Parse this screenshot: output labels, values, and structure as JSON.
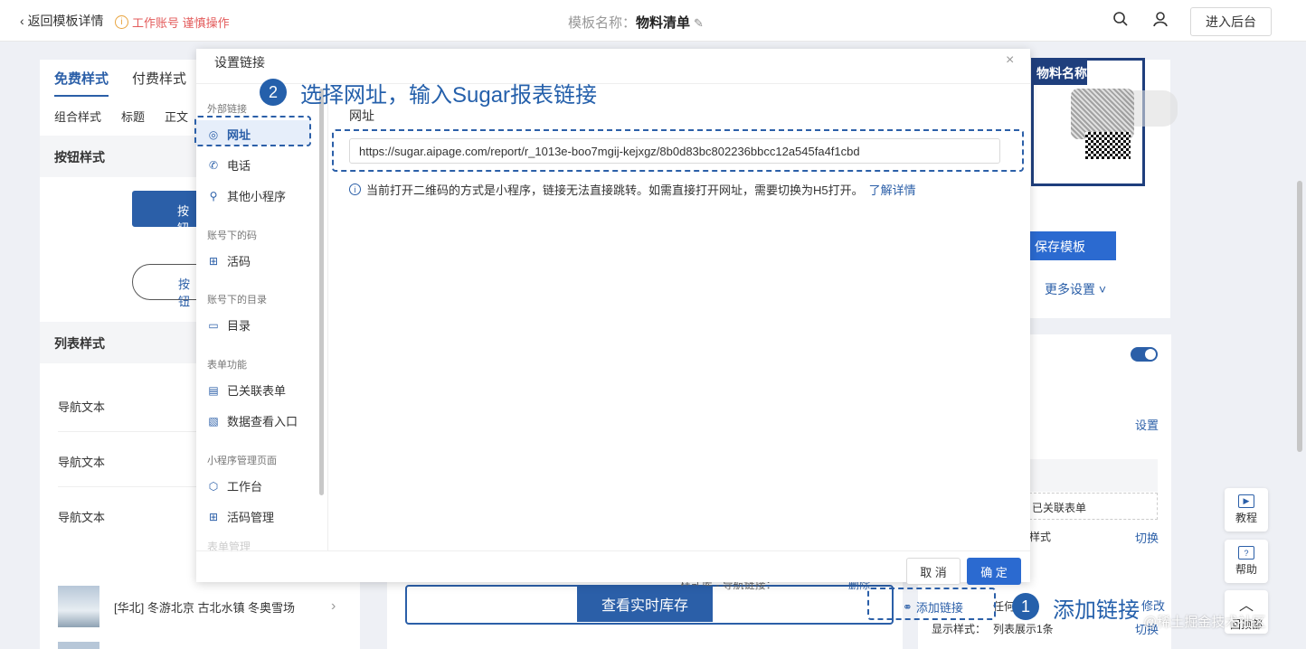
{
  "topbar": {
    "back_label": "返回模板详情",
    "warning_text": "工作账号 谨慎操作",
    "template_name_label": "模板名称：",
    "template_name": "物料清单",
    "enter_backend": "进入后台"
  },
  "left_panel": {
    "tabs": [
      "免费样式",
      "付费样式"
    ],
    "subtabs": [
      "组合样式",
      "标题",
      "正文"
    ],
    "button_section": "按钮样式",
    "button_text": "按钮",
    "list_section": "列表样式",
    "nav_items": [
      "导航文本",
      "导航文本",
      "导航文本"
    ],
    "list_item_text": "[华北] 冬游北京 古北水镇 冬奥雪场"
  },
  "center": {
    "stock_button": "查看实时库存",
    "behind_text": "样式库 - 导航链接：",
    "delete_text": "删除",
    "add_link": "添加链接"
  },
  "right": {
    "poster_title": "物料名称",
    "save_template": "保存模板",
    "more_settings": "更多设置",
    "setting_link": "设置",
    "linked_form": "已关联表单",
    "style_label": "样式",
    "switch_label": "切换",
    "modify_label": "修改",
    "any_label": "任何",
    "display_style": "显示样式：",
    "display_value": "列表展示1条",
    "help_btns": [
      "教程",
      "帮助",
      "回顶部"
    ]
  },
  "modal": {
    "title": "设置链接",
    "groups": [
      {
        "title": "外部链接",
        "items": [
          {
            "label": "网址",
            "icon": "globe-icon"
          },
          {
            "label": "电话",
            "icon": "phone-icon"
          },
          {
            "label": "其他小程序",
            "icon": "link-icon"
          }
        ]
      },
      {
        "title": "账号下的码",
        "items": [
          {
            "label": "活码",
            "icon": "grid-icon"
          }
        ]
      },
      {
        "title": "账号下的目录",
        "items": [
          {
            "label": "目录",
            "icon": "folder-icon"
          }
        ]
      },
      {
        "title": "表单功能",
        "items": [
          {
            "label": "已关联表单",
            "icon": "form-icon"
          },
          {
            "label": "数据查看入口",
            "icon": "search-doc-icon"
          }
        ]
      },
      {
        "title": "小程序管理页面",
        "items": [
          {
            "label": "工作台",
            "icon": "cube-icon"
          },
          {
            "label": "活码管理",
            "icon": "grid-icon"
          }
        ]
      }
    ],
    "faded_item": "表单管理",
    "url_label": "网址",
    "url_value": "https://sugar.aipage.com/report/r_1013e-boo7mgij-kejxgz/8b0d83bc802236bbcc12a545fa4f1cbd",
    "hint": "当前打开二维码的方式是小程序，链接无法直接跳转。如需直接打开网址，需要切换为H5打开。",
    "hint_link": "了解详情",
    "cancel": "取 消",
    "ok": "确 定"
  },
  "annotations": {
    "step1_num": "1",
    "step1_text": "添加链接",
    "step2_num": "2",
    "step2_text": "选择网址，输入Sugar报表链接"
  },
  "watermark": "@稀土掘金技术社区",
  "colors": {
    "primary": "#2b5fa8",
    "warning": "#e35b5b",
    "annotation": "#2560ab"
  }
}
